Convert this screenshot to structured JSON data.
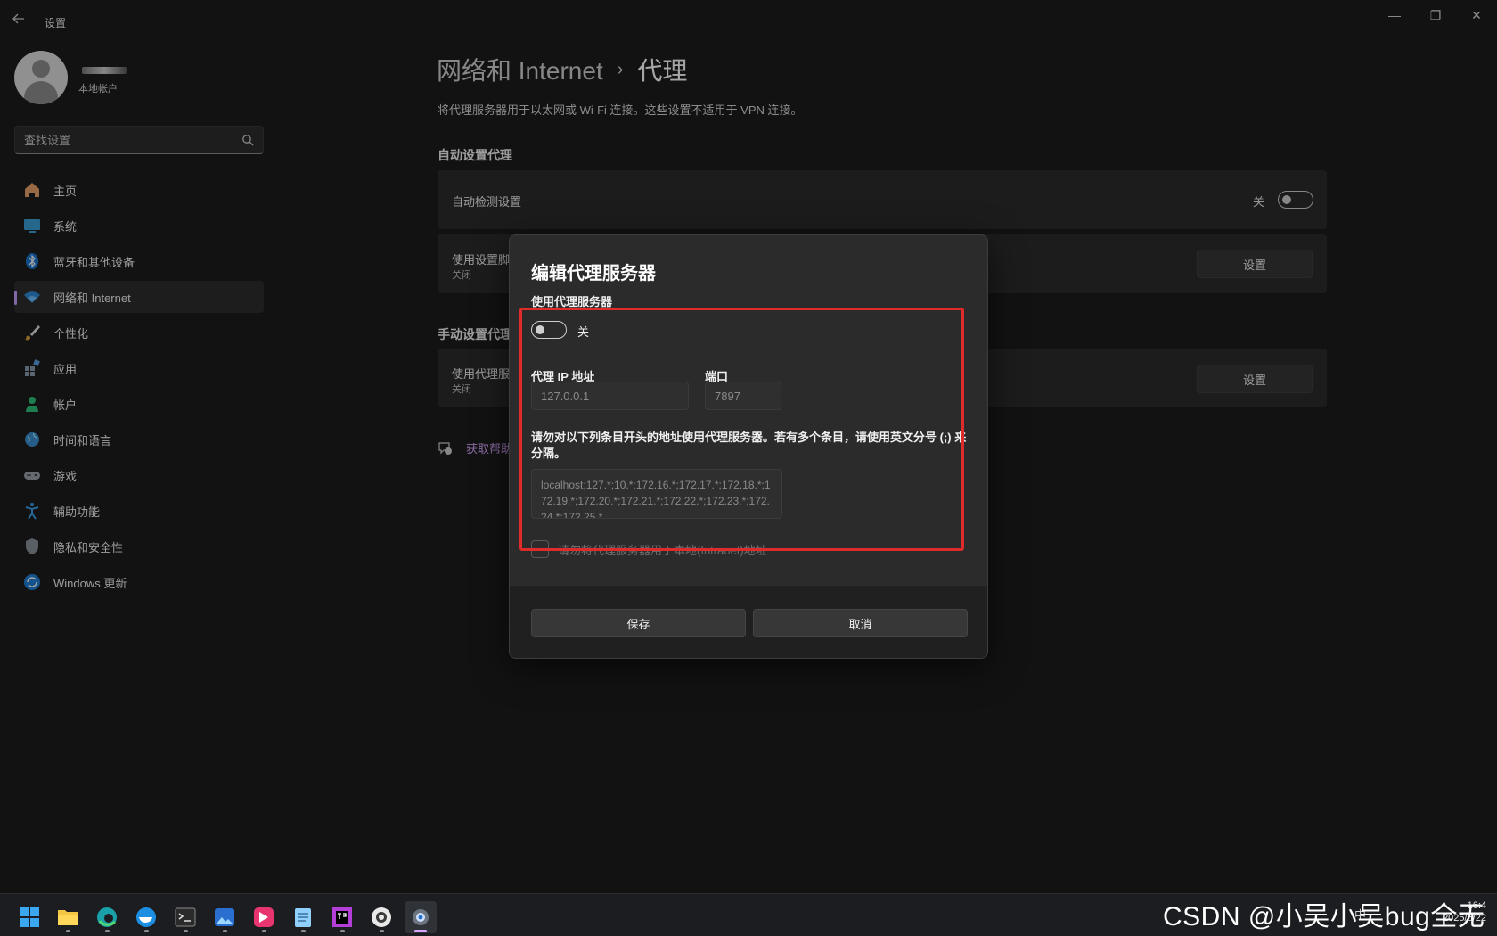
{
  "window": {
    "app_title": "设置",
    "controls": {
      "minimize": "—",
      "restore": "❐",
      "close": "✕"
    }
  },
  "profile": {
    "account_type": "本地帐户"
  },
  "search": {
    "placeholder": "查找设置"
  },
  "sidebar": {
    "items": [
      {
        "label": "主页",
        "icon": "home-icon"
      },
      {
        "label": "系统",
        "icon": "system-icon"
      },
      {
        "label": "蓝牙和其他设备",
        "icon": "bluetooth-icon"
      },
      {
        "label": "网络和 Internet",
        "icon": "wifi-icon",
        "active": true
      },
      {
        "label": "个性化",
        "icon": "brush-icon"
      },
      {
        "label": "应用",
        "icon": "apps-icon"
      },
      {
        "label": "帐户",
        "icon": "account-icon"
      },
      {
        "label": "时间和语言",
        "icon": "globe-icon"
      },
      {
        "label": "游戏",
        "icon": "gamepad-icon"
      },
      {
        "label": "辅助功能",
        "icon": "accessibility-icon"
      },
      {
        "label": "隐私和安全性",
        "icon": "shield-icon"
      },
      {
        "label": "Windows 更新",
        "icon": "update-icon"
      }
    ]
  },
  "main": {
    "breadcrumb_parent": "网络和 Internet",
    "breadcrumb_separator": "›",
    "breadcrumb_current": "代理",
    "description": "将代理服务器用于以太网或 Wi-Fi 连接。这些设置不适用于 VPN 连接。",
    "auto_section_title": "自动设置代理",
    "auto_detect": {
      "label": "自动检测设置",
      "state": "关"
    },
    "setup_script": {
      "label": "使用设置脚",
      "sub": "关闭",
      "button": "设置"
    },
    "manual_section_title": "手动设置代理",
    "manual_proxy": {
      "label": "使用代理服",
      "sub": "关闭",
      "button": "设置"
    },
    "help_label": "获取帮助"
  },
  "dialog": {
    "title": "编辑代理服务器",
    "use_proxy_label": "使用代理服务器",
    "toggle_state": "关",
    "ip_label": "代理 IP 地址",
    "ip_value": "127.0.0.1",
    "port_label": "端口",
    "port_value": "7897",
    "exceptions_label": "请勿对以下列条目开头的地址使用代理服务器。若有多个条目，请使用英文分号 (;) 来分隔。",
    "exceptions_value": "localhost;127.*;10.*;172.16.*;172.17.*;172.18.*;172.19.*;172.20.*;172.21.*;172.22.*;172.23.*;172.24.*;172.25.*",
    "local_checkbox_label": "请勿将代理服务器用于本地(Intranet)地址",
    "save_label": "保存",
    "cancel_label": "取消"
  },
  "taskbar": {
    "apps": [
      "start-icon",
      "file-explorer-icon",
      "edge-icon",
      "docker-icon",
      "terminal-icon",
      "photos-icon",
      "app-icon",
      "notepad-icon",
      "jetbrains-icon",
      "browser-icon",
      "settings-icon"
    ],
    "ime": "中",
    "time": "16:4",
    "date": "2025/5/22"
  },
  "watermark": "CSDN @小吴小吴bug全无",
  "colors": {
    "accent": "#c9a0ff",
    "highlight": "#e02b2b",
    "background": "#1c1c1c",
    "card": "#2b2b2b"
  }
}
